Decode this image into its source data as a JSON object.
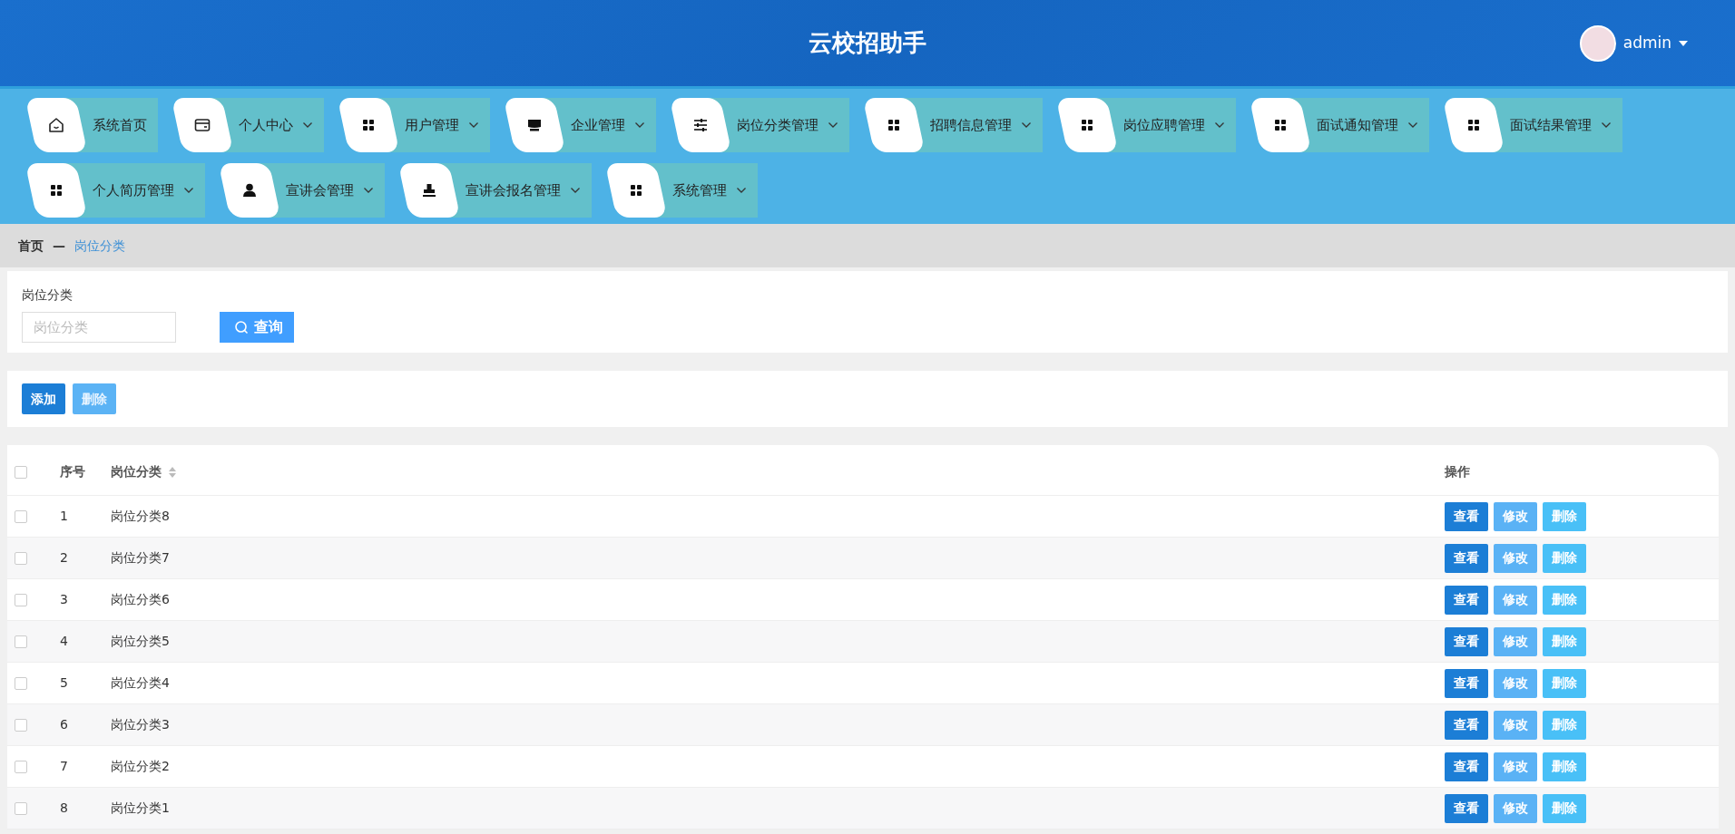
{
  "header": {
    "title": "云校招助手",
    "user": "admin"
  },
  "nav": {
    "items": [
      {
        "label": "系统首页",
        "kind": "home",
        "dropdown": false
      },
      {
        "label": "个人中心",
        "kind": "card",
        "dropdown": true
      },
      {
        "label": "用户管理",
        "kind": "grid",
        "dropdown": true
      },
      {
        "label": "企业管理",
        "kind": "shop",
        "dropdown": true
      },
      {
        "label": "岗位分类管理",
        "kind": "sliders",
        "dropdown": true
      },
      {
        "label": "招聘信息管理",
        "kind": "grid",
        "dropdown": true
      },
      {
        "label": "岗位应聘管理",
        "kind": "grid",
        "dropdown": true
      },
      {
        "label": "面试通知管理",
        "kind": "grid",
        "dropdown": true
      },
      {
        "label": "面试结果管理",
        "kind": "grid",
        "dropdown": true
      },
      {
        "label": "个人简历管理",
        "kind": "grid",
        "dropdown": true
      },
      {
        "label": "宣讲会管理",
        "kind": "person",
        "dropdown": true
      },
      {
        "label": "宣讲会报名管理",
        "kind": "stamp",
        "dropdown": true
      },
      {
        "label": "系统管理",
        "kind": "grid",
        "dropdown": true
      }
    ]
  },
  "breadcrumb": {
    "separator": "—",
    "items": [
      {
        "label": "首页",
        "selected": false
      },
      {
        "label": "岗位分类",
        "selected": true
      }
    ]
  },
  "search": {
    "label": "岗位分类",
    "placeholder": "岗位分类",
    "button": "查询"
  },
  "actions": [
    {
      "label": "添加",
      "disabled": false
    },
    {
      "label": "删除",
      "disabled": true
    }
  ],
  "table": {
    "all_checked": false,
    "columns": [
      {
        "label": "序号",
        "sortable": false
      },
      {
        "label": "岗位分类",
        "sortable": true
      },
      {
        "label": "操作",
        "sortable": false
      }
    ],
    "rows": [
      {
        "index": "1",
        "name": "岗位分类8",
        "checked": false,
        "actions": [
          {
            "label": "查看",
            "kind": "view"
          },
          {
            "label": "修改",
            "kind": "edit"
          },
          {
            "label": "删除",
            "kind": "delete"
          }
        ]
      },
      {
        "index": "2",
        "name": "岗位分类7",
        "checked": false,
        "actions": [
          {
            "label": "查看",
            "kind": "view"
          },
          {
            "label": "修改",
            "kind": "edit"
          },
          {
            "label": "删除",
            "kind": "delete"
          }
        ]
      },
      {
        "index": "3",
        "name": "岗位分类6",
        "checked": false,
        "actions": [
          {
            "label": "查看",
            "kind": "view"
          },
          {
            "label": "修改",
            "kind": "edit"
          },
          {
            "label": "删除",
            "kind": "delete"
          }
        ]
      },
      {
        "index": "4",
        "name": "岗位分类5",
        "checked": false,
        "actions": [
          {
            "label": "查看",
            "kind": "view"
          },
          {
            "label": "修改",
            "kind": "edit"
          },
          {
            "label": "删除",
            "kind": "delete"
          }
        ]
      },
      {
        "index": "5",
        "name": "岗位分类4",
        "checked": false,
        "actions": [
          {
            "label": "查看",
            "kind": "view"
          },
          {
            "label": "修改",
            "kind": "edit"
          },
          {
            "label": "删除",
            "kind": "delete"
          }
        ]
      },
      {
        "index": "6",
        "name": "岗位分类3",
        "checked": false,
        "actions": [
          {
            "label": "查看",
            "kind": "view"
          },
          {
            "label": "修改",
            "kind": "edit"
          },
          {
            "label": "删除",
            "kind": "delete"
          }
        ]
      },
      {
        "index": "7",
        "name": "岗位分类2",
        "checked": false,
        "actions": [
          {
            "label": "查看",
            "kind": "view"
          },
          {
            "label": "修改",
            "kind": "edit"
          },
          {
            "label": "删除",
            "kind": "delete"
          }
        ]
      },
      {
        "index": "8",
        "name": "岗位分类1",
        "checked": false,
        "actions": [
          {
            "label": "查看",
            "kind": "view"
          },
          {
            "label": "修改",
            "kind": "edit"
          },
          {
            "label": "删除",
            "kind": "delete"
          }
        ]
      }
    ]
  }
}
